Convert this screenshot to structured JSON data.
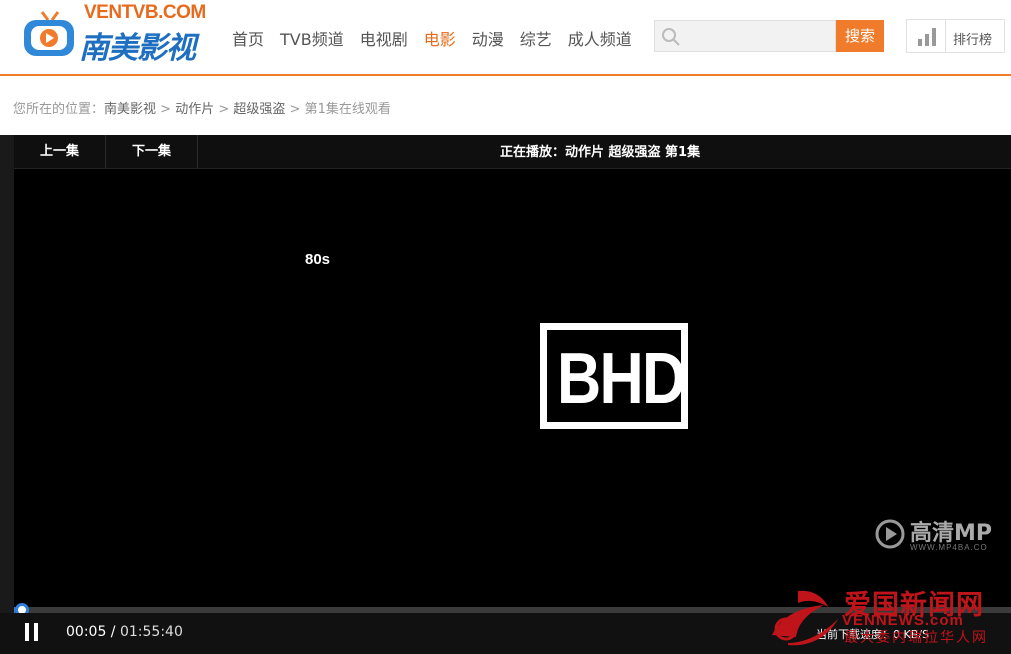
{
  "site": {
    "brand_en": "VENTVB.COM",
    "brand_cn": "南美影视"
  },
  "nav": {
    "items": [
      {
        "label": "首页",
        "active": false
      },
      {
        "label": "TVB频道",
        "active": false
      },
      {
        "label": "电视剧",
        "active": false
      },
      {
        "label": "电影",
        "active": true
      },
      {
        "label": "动漫",
        "active": false
      },
      {
        "label": "综艺",
        "active": false
      },
      {
        "label": "成人频道",
        "active": false
      }
    ]
  },
  "search": {
    "placeholder": "",
    "button_label": "搜索"
  },
  "ranking": {
    "label": "排行榜"
  },
  "breadcrumb": {
    "prefix": "您所在的位置：",
    "items": [
      "南美影视",
      "动作片",
      "超级强盗"
    ],
    "separator": " > ",
    "current": "第1集在线观看"
  },
  "player": {
    "prev_label": "上一集",
    "next_label": "下一集",
    "now_playing": "正在播放：动作片 超级强盗 第1集",
    "overlay_80s": "80s",
    "bhd_logo": "BHD",
    "hd_watermark": "高清MP",
    "hd_watermark_url": "WWW.MP4BA.CO",
    "current_time": "00:05",
    "total_time": "01:55:40",
    "time_separator": " / ",
    "progress_fraction": 0.0007,
    "download_speed": "当前下载速度：0 KB/S"
  },
  "watermark": {
    "line1": "爱国新闻网",
    "line2": "VENNEWS.com",
    "line3": "最大委内瑞拉华人网"
  },
  "colors": {
    "accent": "#f07b2b",
    "brand_blue": "#1f6fc0",
    "progress_blue": "#2f7fd9",
    "watermark_red": "#c0141b"
  },
  "icons": {
    "logo": "tv-icon",
    "search": "search-icon",
    "ranking": "bar-chart-icon",
    "play_state": "pause-icon"
  }
}
